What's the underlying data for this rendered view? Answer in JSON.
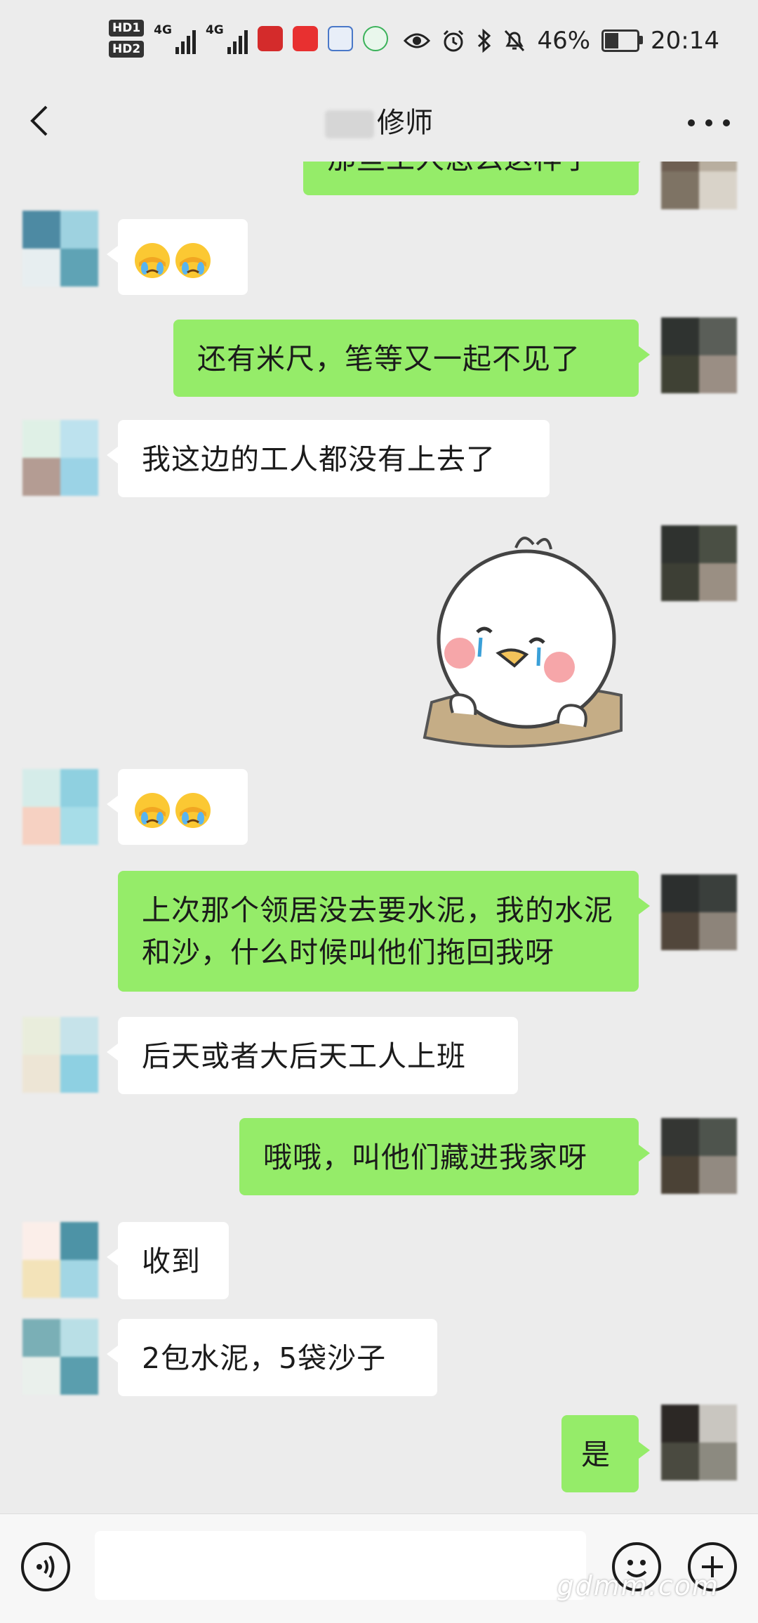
{
  "status_bar": {
    "hd1": "HD1",
    "hd2": "HD2",
    "net1": "4G",
    "net2": "4G",
    "battery": "46%",
    "battery_level": 0.46,
    "time": "20:14",
    "icons": [
      "eye-icon",
      "alarm-icon",
      "bluetooth-icon",
      "mute-icon",
      "battery-icon"
    ]
  },
  "header": {
    "title": "修师",
    "back_icon": "chevron-left-icon",
    "more_icon": "more-dots-icon"
  },
  "messages": [
    {
      "from": "me",
      "text": "那些工人怎么这样子"
    },
    {
      "from": "other",
      "emoji_count": 2,
      "emoji": "facepalm-cry-emoji"
    },
    {
      "from": "me",
      "text": "还有米尺，笔等又一起不见了"
    },
    {
      "from": "other",
      "text": "我这边的工人都没有上去了"
    },
    {
      "from": "me",
      "sticker": "crying-chick-sticker"
    },
    {
      "from": "other",
      "emoji_count": 2,
      "emoji": "facepalm-cry-emoji"
    },
    {
      "from": "me",
      "text": "上次那个领居没去要水泥，我的水泥和沙，什么时候叫他们拖回我呀"
    },
    {
      "from": "other",
      "text": "后天或者大后天工人上班"
    },
    {
      "from": "me",
      "text": "哦哦，叫他们藏进我家呀"
    },
    {
      "from": "other",
      "text": "收到"
    },
    {
      "from": "other",
      "text": "2包水泥，5袋沙子"
    },
    {
      "from": "me",
      "text": "是"
    }
  ],
  "input_bar": {
    "voice_icon": "voice-icon",
    "emoji_icon": "smiley-icon",
    "plus_icon": "plus-icon",
    "input_value": ""
  },
  "watermark": "gdmm.com"
}
